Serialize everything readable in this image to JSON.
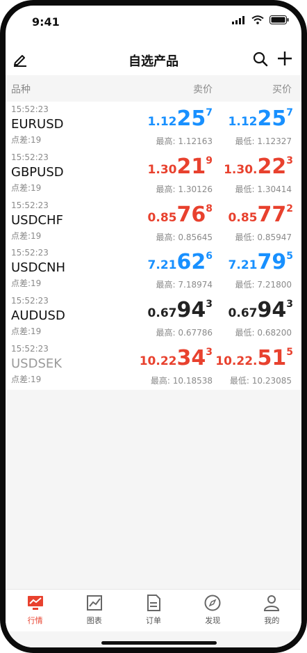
{
  "status_bar": {
    "time": "9:41"
  },
  "nav": {
    "title": "自选产品"
  },
  "columns": {
    "name": "品种",
    "sell": "卖价",
    "buy": "买价"
  },
  "quotes": [
    {
      "time": "15:52:23",
      "symbol": "EURUSD",
      "spread": "点差:19",
      "symbol_color": "#111111",
      "sell": {
        "prefix": "1.12",
        "big": "25",
        "sup": "7",
        "color": "#1890ff",
        "hl": "最高: 1.12163"
      },
      "buy": {
        "prefix": "1.12",
        "big": "25",
        "sup": "7",
        "color": "#1890ff",
        "hl": "最低: 1.12327"
      }
    },
    {
      "time": "15:52:23",
      "symbol": "GBPUSD",
      "spread": "点差:19",
      "symbol_color": "#111111",
      "sell": {
        "prefix": "1.30",
        "big": "21",
        "sup": "9",
        "color": "#e8412e",
        "hl": "最高: 1.30126"
      },
      "buy": {
        "prefix": "1.30.",
        "big": "22",
        "sup": "3",
        "color": "#e8412e",
        "hl": "最低: 1.30414"
      }
    },
    {
      "time": "15:52:23",
      "symbol": "USDCHF",
      "spread": "点差:19",
      "symbol_color": "#111111",
      "sell": {
        "prefix": "0.85",
        "big": "76",
        "sup": "8",
        "color": "#e8412e",
        "hl": "最高: 0.85645"
      },
      "buy": {
        "prefix": "0.85",
        "big": "77",
        "sup": "2",
        "color": "#e8412e",
        "hl": "最低: 0.85947"
      }
    },
    {
      "time": "15:52:23",
      "symbol": "USDCNH",
      "spread": "点差:19",
      "symbol_color": "#111111",
      "sell": {
        "prefix": "7.21",
        "big": "62",
        "sup": "6",
        "color": "#1890ff",
        "hl": "最高: 7.18974"
      },
      "buy": {
        "prefix": "7.21",
        "big": "79",
        "sup": "5",
        "color": "#1890ff",
        "hl": "最低: 7.21800"
      }
    },
    {
      "time": "15:52:23",
      "symbol": "AUDUSD",
      "spread": "点差:19",
      "symbol_color": "#111111",
      "sell": {
        "prefix": "0.67",
        "big": "94",
        "sup": "3",
        "color": "#222222",
        "hl": "最高: 0.67786"
      },
      "buy": {
        "prefix": "0.67",
        "big": "94",
        "sup": "3",
        "color": "#222222",
        "hl": "最低: 0.68200"
      }
    },
    {
      "time": "15:52:23",
      "symbol": "USDSEK",
      "spread": "点差:19",
      "symbol_color": "#9a9a9a",
      "sell": {
        "prefix": "10.22",
        "big": "34",
        "sup": "3",
        "color": "#e8412e",
        "hl": "最高: 10.18538"
      },
      "buy": {
        "prefix": "10.22.",
        "big": "51",
        "sup": "5",
        "color": "#e8412e",
        "hl": "最低: 10.23085"
      }
    }
  ],
  "tabs": [
    {
      "label": "行情",
      "icon": "market-icon",
      "active": true
    },
    {
      "label": "图表",
      "icon": "chart-icon",
      "active": false
    },
    {
      "label": "订单",
      "icon": "order-icon",
      "active": false
    },
    {
      "label": "发现",
      "icon": "discover-icon",
      "active": false
    },
    {
      "label": "我的",
      "icon": "profile-icon",
      "active": false
    }
  ],
  "colors": {
    "accent": "#e8412e",
    "rise": "#1890ff",
    "fall": "#e8412e"
  }
}
